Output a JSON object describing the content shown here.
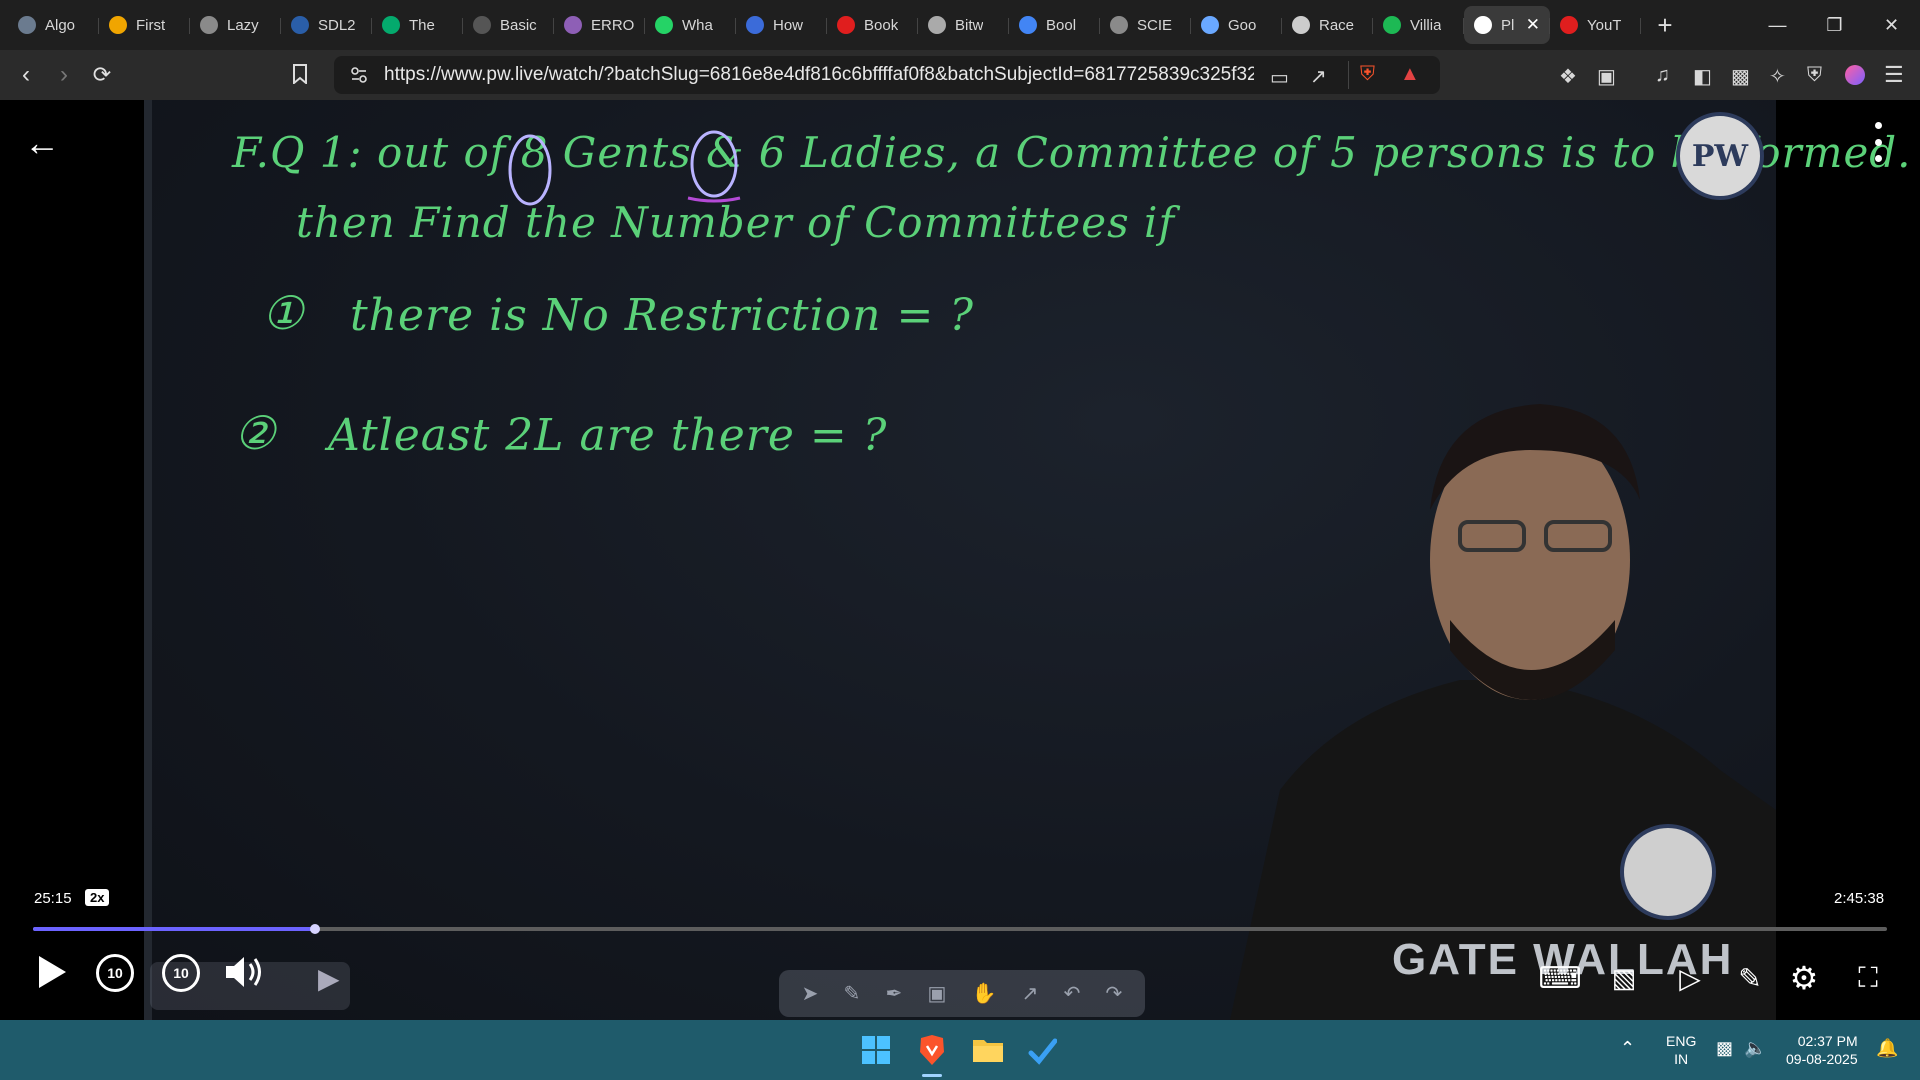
{
  "browser": {
    "tabs": [
      {
        "label": "Algo",
        "icon": "globe-icon",
        "color": "#6b7b8f"
      },
      {
        "label": "First",
        "icon": "sorting-icon",
        "color": "#f0a500"
      },
      {
        "label": "Lazy",
        "icon": "globe-icon",
        "color": "#8a8a8a"
      },
      {
        "label": "SDL2",
        "icon": "sdl-icon",
        "color": "#2a5ea8"
      },
      {
        "label": "The",
        "icon": "w3schools-icon",
        "color": "#04aa6d"
      },
      {
        "label": "Basic",
        "icon": "mdn-icon",
        "color": "#555"
      },
      {
        "label": "ERRO",
        "icon": "brain-icon",
        "color": "#8e5fb6"
      },
      {
        "label": "Wha",
        "icon": "whatsapp-icon",
        "color": "#25d366"
      },
      {
        "label": "How",
        "icon": "bookmark-icon",
        "color": "#3b6bd9"
      },
      {
        "label": "Book",
        "icon": "youtube-icon",
        "color": "#e01e1e"
      },
      {
        "label": "Bitw",
        "icon": "bitwise-icon",
        "color": "#aaa"
      },
      {
        "label": "Bool",
        "icon": "google-icon",
        "color": "#4285f4"
      },
      {
        "label": "SCIE",
        "icon": "globe-icon",
        "color": "#8a8a8a"
      },
      {
        "label": "Goo",
        "icon": "gemini-icon",
        "color": "#6aa8ff"
      },
      {
        "label": "Race",
        "icon": "openai-icon",
        "color": "#ccc"
      },
      {
        "label": "Villia",
        "icon": "spotify-icon",
        "color": "#1db954"
      },
      {
        "label": "Pl",
        "icon": "speaker-icon",
        "color": "#fff",
        "active": true
      },
      {
        "label": "YouT",
        "icon": "youtube-icon",
        "color": "#e01e1e"
      }
    ],
    "new_tab": "+",
    "url": "https://www.pw.live/watch/?batchSlug=6816e8e4df816c6bffffaf0f8&batchSubjectId=6817725839c325f3224e28d..."
  },
  "board": {
    "line1": "F.Q 1: out of 8 Gents & 6 Ladies, a Committee of 5 persons is to be formed.",
    "line2": "then Find the Number of Committees if",
    "item1_num": "①",
    "item1": "there is No Restriction = ?",
    "item2_num": "②",
    "item2": "Atleast 2L are there = ?",
    "logo": "PW",
    "watermark": "GATE WALLAH"
  },
  "player": {
    "current_time": "25:15",
    "speed": "2x",
    "total_time": "2:45:38",
    "progress_fraction": 0.152,
    "rewind_label": "10",
    "forward_label": "10"
  },
  "taskbar": {
    "lang": "ENG",
    "region": "IN",
    "time": "02:37 PM",
    "date": "09-08-2025"
  }
}
